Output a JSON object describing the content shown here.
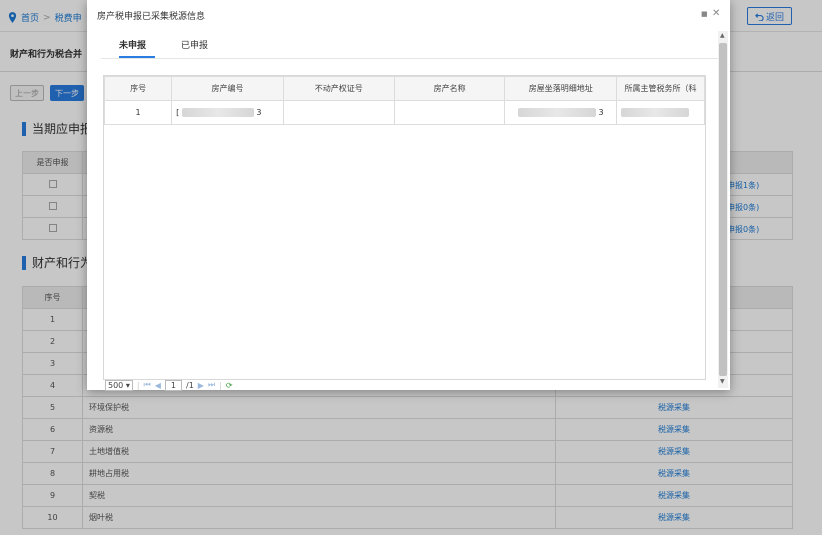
{
  "breadcrumb": {
    "home": "首页",
    "current": "税费申"
  },
  "back_button": "返回",
  "subtitle": "财产和行为税合并",
  "steps": {
    "prev": "上一步",
    "next": "下一步"
  },
  "section1": {
    "title": "当期应申报",
    "header_first": "是否申报",
    "rows_links": [
      "申报1条)",
      "申报0条)",
      "申报0条)"
    ]
  },
  "section2": {
    "title": "财产和行为",
    "header_num": "序号",
    "rows": [
      {
        "num": "1",
        "name": "",
        "action": ""
      },
      {
        "num": "2",
        "name": "",
        "action": ""
      },
      {
        "num": "3",
        "name": "",
        "action": ""
      },
      {
        "num": "4",
        "name": "",
        "action": ""
      },
      {
        "num": "5",
        "name": "环境保护税",
        "action": "税源采集"
      },
      {
        "num": "6",
        "name": "资源税",
        "action": "税源采集"
      },
      {
        "num": "7",
        "name": "土地增值税",
        "action": "税源采集"
      },
      {
        "num": "8",
        "name": "耕地占用税",
        "action": "税源采集"
      },
      {
        "num": "9",
        "name": "契税",
        "action": "税源采集"
      },
      {
        "num": "10",
        "name": "烟叶税",
        "action": "税源采集"
      }
    ]
  },
  "modal": {
    "title": "房产税申报已采集税源信息",
    "tabs": [
      "未申报",
      "已申报"
    ],
    "columns": [
      "序号",
      "房产编号",
      "不动产权证号",
      "房产名称",
      "房屋坐落明细地址",
      "所属主管税务所（科"
    ],
    "rows": [
      {
        "num": "1",
        "code_prefix": "[",
        "code_suffix": "3",
        "cert": "",
        "name": "",
        "addr_suffix": "3",
        "office": ""
      }
    ],
    "pager": {
      "page_size": "500",
      "page": "1",
      "total_pages": "/1"
    }
  }
}
